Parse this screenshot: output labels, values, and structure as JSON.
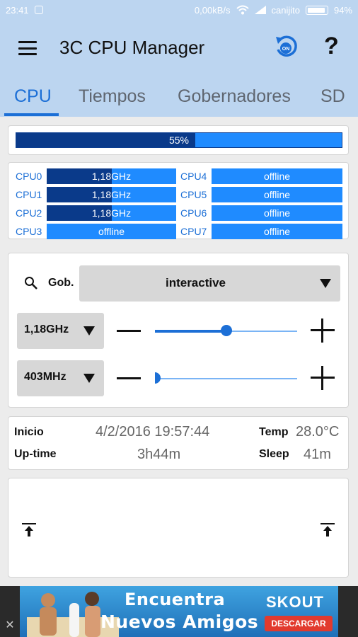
{
  "status_bar": {
    "time": "23:41",
    "speed": "0,00kB/s",
    "carrier": "canijito",
    "battery": "94%"
  },
  "app": {
    "title": "3C CPU Manager",
    "help_label": "?"
  },
  "tabs": [
    {
      "label": "CPU",
      "active": true
    },
    {
      "label": "Tiempos",
      "active": false
    },
    {
      "label": "Gobernadores",
      "active": false
    },
    {
      "label": "SD",
      "active": false
    }
  ],
  "load": {
    "text": "55%",
    "value": 0.55
  },
  "cores": [
    {
      "label": "CPU0",
      "text": "1,18GHz",
      "fill": 0.5
    },
    {
      "label": "CPU1",
      "text": "1,18GHz",
      "fill": 0.5
    },
    {
      "label": "CPU2",
      "text": "1,18GHz",
      "fill": 0.5
    },
    {
      "label": "CPU3",
      "text": "offline",
      "fill": 0
    },
    {
      "label": "CPU4",
      "text": "offline",
      "fill": 0
    },
    {
      "label": "CPU5",
      "text": "offline",
      "fill": 0
    },
    {
      "label": "CPU6",
      "text": "offline",
      "fill": 0
    },
    {
      "label": "CPU7",
      "text": "offline",
      "fill": 0
    }
  ],
  "governor": {
    "label": "Gob.",
    "value": "interactive"
  },
  "max_freq": {
    "value": "1,18GHz",
    "slider": 0.5
  },
  "min_freq": {
    "value": "403MHz",
    "slider": 0.0
  },
  "info": {
    "inicio_label": "Inicio",
    "inicio_value": "4/2/2016 19:57:44",
    "uptime_label": "Up-time",
    "uptime_value": "3h44m",
    "temp_label": "Temp",
    "temp_value": "28.0°C",
    "sleep_label": "Sleep",
    "sleep_value": "41m"
  },
  "ad": {
    "line1": "Encuentra",
    "line2": "Nuevos Amigos",
    "brand": "SKOUT",
    "cta": "DESCARGAR",
    "close": "✕"
  },
  "colors": {
    "accent": "#1c6fd6",
    "bar_bg": "#1f8bff",
    "bar_fill": "#0a3a8a",
    "app_bar": "#bcd5f0"
  }
}
